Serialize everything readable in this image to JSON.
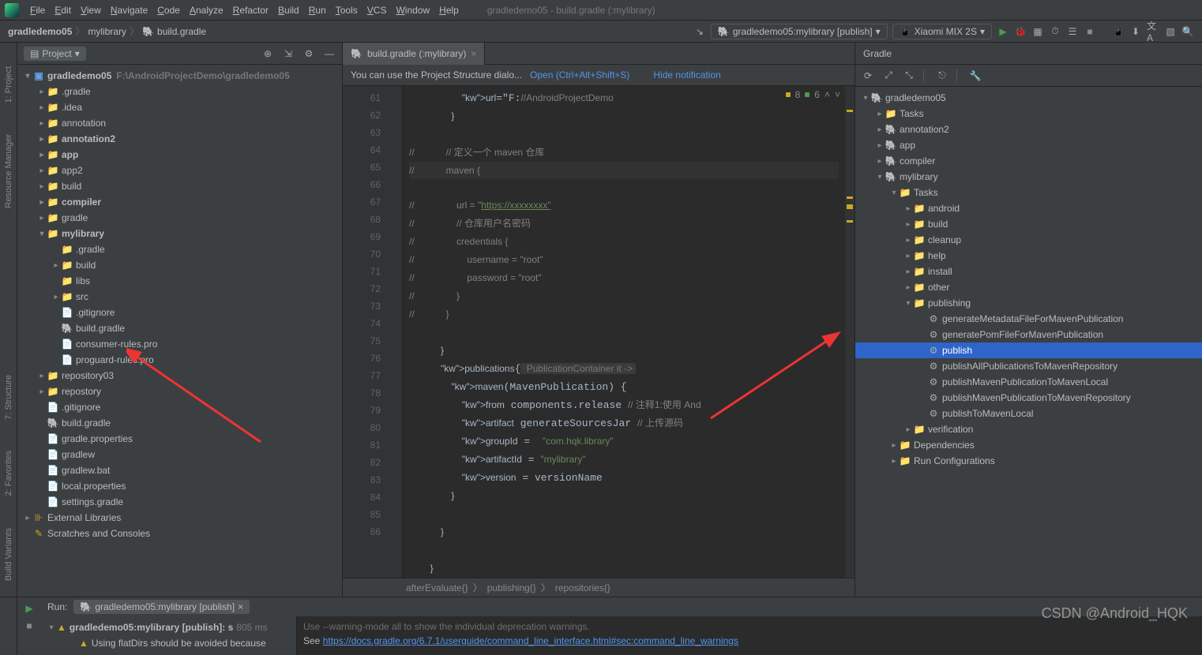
{
  "menu": {
    "items": [
      "File",
      "Edit",
      "View",
      "Navigate",
      "Code",
      "Analyze",
      "Refactor",
      "Build",
      "Run",
      "Tools",
      "VCS",
      "Window",
      "Help"
    ],
    "title": "gradledemo05 - build.gradle (:mylibrary)"
  },
  "breadcrumb": {
    "root": "gradledemo05",
    "module": "mylibrary",
    "file": "build.gradle"
  },
  "runConfig": {
    "label": "gradledemo05:mylibrary [publish]",
    "device": "Xiaomi MIX 2S"
  },
  "projectPanel": {
    "title": "Project"
  },
  "projectTree": {
    "root": {
      "name": "gradledemo05",
      "path": "F:\\AndroidProjectDemo\\gradledemo05"
    },
    "items": [
      {
        "d": 1,
        "name": ".gradle",
        "icon": "folder-o",
        "arrow": "r"
      },
      {
        "d": 1,
        "name": ".idea",
        "icon": "folder-o",
        "arrow": "r"
      },
      {
        "d": 1,
        "name": "annotation",
        "icon": "folder-b",
        "arrow": "r"
      },
      {
        "d": 1,
        "name": "annotation2",
        "icon": "folder-b",
        "arrow": "r",
        "bold": true
      },
      {
        "d": 1,
        "name": "app",
        "icon": "folder-b",
        "arrow": "r",
        "bold": true
      },
      {
        "d": 1,
        "name": "app2",
        "icon": "folder-b",
        "arrow": "r"
      },
      {
        "d": 1,
        "name": "build",
        "icon": "folder-o",
        "arrow": "r"
      },
      {
        "d": 1,
        "name": "compiler",
        "icon": "folder-b",
        "arrow": "r",
        "bold": true
      },
      {
        "d": 1,
        "name": "gradle",
        "icon": "folder-g",
        "arrow": "r"
      },
      {
        "d": 1,
        "name": "mylibrary",
        "icon": "folder-b",
        "arrow": "d",
        "bold": true
      },
      {
        "d": 2,
        "name": ".gradle",
        "icon": "folder-o"
      },
      {
        "d": 2,
        "name": "build",
        "icon": "folder-o",
        "arrow": "r"
      },
      {
        "d": 2,
        "name": "libs",
        "icon": "folder-g"
      },
      {
        "d": 2,
        "name": "src",
        "icon": "folder-g",
        "arrow": "r"
      },
      {
        "d": 2,
        "name": ".gitignore",
        "icon": "file-g"
      },
      {
        "d": 2,
        "name": "build.gradle",
        "icon": "elephant"
      },
      {
        "d": 2,
        "name": "consumer-rules.pro",
        "icon": "file-g"
      },
      {
        "d": 2,
        "name": "proguard-rules.pro",
        "icon": "file-g"
      },
      {
        "d": 1,
        "name": "repository03",
        "icon": "folder-g",
        "arrow": "r"
      },
      {
        "d": 1,
        "name": "repostory",
        "icon": "folder-g",
        "arrow": "r"
      },
      {
        "d": 1,
        "name": ".gitignore",
        "icon": "file-g"
      },
      {
        "d": 1,
        "name": "build.gradle",
        "icon": "elephant"
      },
      {
        "d": 1,
        "name": "gradle.properties",
        "icon": "file-g"
      },
      {
        "d": 1,
        "name": "gradlew",
        "icon": "file-g"
      },
      {
        "d": 1,
        "name": "gradlew.bat",
        "icon": "file-g"
      },
      {
        "d": 1,
        "name": "local.properties",
        "icon": "file-g"
      },
      {
        "d": 1,
        "name": "settings.gradle",
        "icon": "file-g"
      }
    ],
    "extLibs": "External Libraries",
    "scratches": "Scratches and Consoles"
  },
  "editor": {
    "tabLabel": "build.gradle (:mylibrary)",
    "noticeText": "You can use the Project Structure dialo...",
    "noticeOpen": "Open (Ctrl+Alt+Shift+S)",
    "noticeHide": "Hide notification",
    "inspWarn": "8",
    "inspOk": "6",
    "lines": [
      {
        "n": 61,
        "t": "                    url=\"F://AndroidProjectDemo",
        "cls": ""
      },
      {
        "n": 62,
        "t": "                }"
      },
      {
        "n": 63,
        "t": ""
      },
      {
        "n": 64,
        "t": "//            // 定义一个 maven 仓库",
        "cm": true
      },
      {
        "n": 65,
        "t": "//            maven {",
        "cm": true,
        "hl": true
      },
      {
        "n": 66,
        "t": "//                url = \"https://xxxxxxxx\"",
        "cm": true,
        "link": true
      },
      {
        "n": 67,
        "t": "//                // 仓库用户名密码",
        "cm": true
      },
      {
        "n": 68,
        "t": "//                credentials {",
        "cm": true
      },
      {
        "n": 69,
        "t": "//                    username = \"root\"",
        "cm": true
      },
      {
        "n": 70,
        "t": "//                    password = \"root\"",
        "cm": true
      },
      {
        "n": 71,
        "t": "//                }",
        "cm": true
      },
      {
        "n": 72,
        "t": "//            }",
        "cm": true
      },
      {
        "n": 73,
        "t": ""
      },
      {
        "n": 74,
        "t": "            }"
      },
      {
        "n": 75,
        "t": "            publications{",
        "hint": " PublicationContainer it ->"
      },
      {
        "n": 76,
        "t": "                maven(MavenPublication) {"
      },
      {
        "n": 77,
        "t": "                    from components.release // 注释1:使用 And"
      },
      {
        "n": 78,
        "t": "                    artifact generateSourcesJar // 上传源码"
      },
      {
        "n": 79,
        "t": "                    groupId =  \"com.hqk.library\""
      },
      {
        "n": 80,
        "t": "                    artifactId = \"mylibrary\""
      },
      {
        "n": 81,
        "t": "                    version = versionName"
      },
      {
        "n": 82,
        "t": "                }"
      },
      {
        "n": 83,
        "t": ""
      },
      {
        "n": 84,
        "t": "            }"
      },
      {
        "n": 85,
        "t": ""
      },
      {
        "n": 86,
        "t": "        }"
      }
    ],
    "crumbs": [
      "afterEvaluate{}",
      "publishing{}",
      "repositories{}"
    ]
  },
  "gradle": {
    "title": "Gradle",
    "root": "gradledemo05",
    "nodes": [
      {
        "d": 1,
        "name": "Tasks",
        "icon": "folder-b",
        "arrow": "r"
      },
      {
        "d": 1,
        "name": "annotation2",
        "icon": "elephant",
        "arrow": "r"
      },
      {
        "d": 1,
        "name": "app",
        "icon": "elephant",
        "arrow": "r"
      },
      {
        "d": 1,
        "name": "compiler",
        "icon": "elephant",
        "arrow": "r"
      },
      {
        "d": 1,
        "name": "mylibrary",
        "icon": "elephant",
        "arrow": "d"
      },
      {
        "d": 2,
        "name": "Tasks",
        "icon": "folder-b",
        "arrow": "d"
      },
      {
        "d": 3,
        "name": "android",
        "icon": "folder-b",
        "arrow": "r"
      },
      {
        "d": 3,
        "name": "build",
        "icon": "folder-b",
        "arrow": "r"
      },
      {
        "d": 3,
        "name": "cleanup",
        "icon": "folder-b",
        "arrow": "r"
      },
      {
        "d": 3,
        "name": "help",
        "icon": "folder-b",
        "arrow": "r"
      },
      {
        "d": 3,
        "name": "install",
        "icon": "folder-b",
        "arrow": "r"
      },
      {
        "d": 3,
        "name": "other",
        "icon": "folder-b",
        "arrow": "r"
      },
      {
        "d": 3,
        "name": "publishing",
        "icon": "folder-b",
        "arrow": "d"
      },
      {
        "d": 4,
        "name": "generateMetadataFileForMavenPublication",
        "icon": "gear"
      },
      {
        "d": 4,
        "name": "generatePomFileForMavenPublication",
        "icon": "gear"
      },
      {
        "d": 4,
        "name": "publish",
        "icon": "gear",
        "sel": true
      },
      {
        "d": 4,
        "name": "publishAllPublicationsToMavenRepository",
        "icon": "gear"
      },
      {
        "d": 4,
        "name": "publishMavenPublicationToMavenLocal",
        "icon": "gear"
      },
      {
        "d": 4,
        "name": "publishMavenPublicationToMavenRepository",
        "icon": "gear"
      },
      {
        "d": 4,
        "name": "publishToMavenLocal",
        "icon": "gear"
      },
      {
        "d": 3,
        "name": "verification",
        "icon": "folder-b",
        "arrow": "r"
      },
      {
        "d": 2,
        "name": "Dependencies",
        "icon": "folder-b",
        "arrow": "r"
      },
      {
        "d": 2,
        "name": "Run Configurations",
        "icon": "folder-b",
        "arrow": "r"
      }
    ]
  },
  "run": {
    "title": "Run:",
    "tab": "gradledemo05:mylibrary [publish]",
    "treeRoot": "gradledemo05:mylibrary [publish]: s",
    "treeTime": "805 ms",
    "treeWarn": "Using flatDirs should be avoided because",
    "console1": "Use  --warning-mode all  to show the individual deprecation warnings.",
    "console2pre": "See ",
    "console2link": "https://docs.gradle.org/6.7.1/userguide/command_line_interface.html#sec:command_line_warnings"
  },
  "sideTabs": {
    "p1": "1: Project",
    "rm": "Resource Manager",
    "st": "7: Structure",
    "fav": "2: Favorites",
    "bv": "Build Variants"
  },
  "watermark": "CSDN @Android_HQK"
}
